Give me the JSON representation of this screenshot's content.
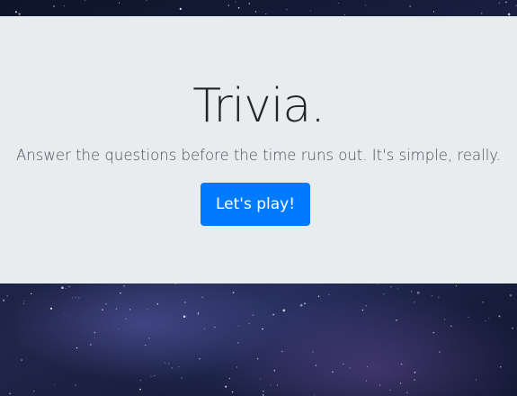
{
  "jumbotron": {
    "title": "Trivia.",
    "subtitle": "Answer the questions before the time runs out. It's simple, really.",
    "play_button_label": "Let's play!"
  },
  "colors": {
    "panel_background": "#e9ecef",
    "button_primary": "#007bff",
    "background_sky": "#1a2144"
  }
}
